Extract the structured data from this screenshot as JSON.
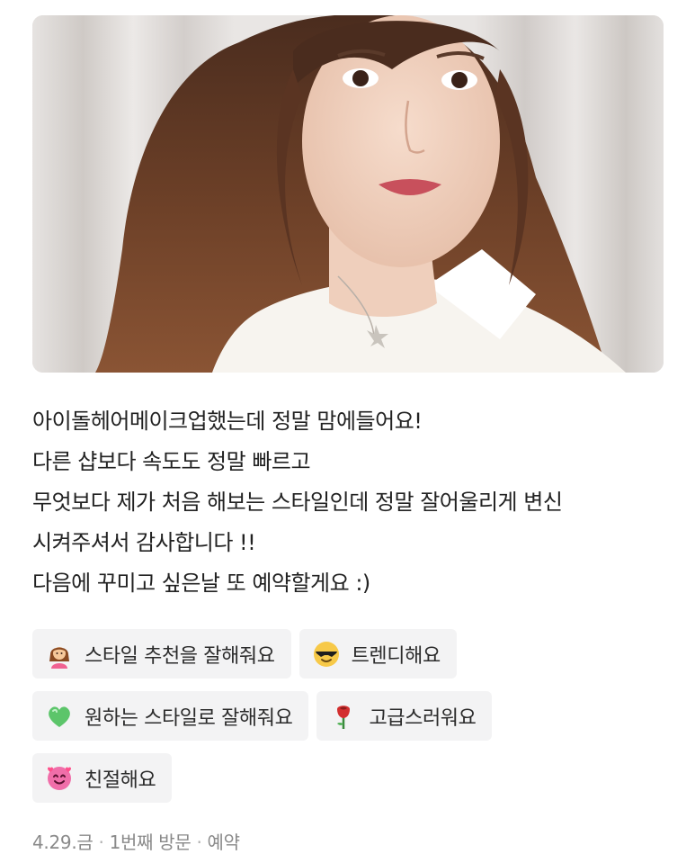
{
  "review": {
    "photo_alt": "selfie",
    "text_lines": [
      "아이돌헤어메이크업했는데 정말 맘에들어요!",
      "다른 샵보다 속도도 정말 빠르고",
      "무엇보다 제가 처음 해보는 스타일인데 정말 잘어울리게 변신",
      "시켜주셔서 감사합니다 !!",
      "다음에 꾸미고 싶은날 또 예약할게요 :)"
    ],
    "keywords": [
      {
        "label": "스타일 추천을 잘해줘요",
        "icon": "woman-hairdresser-icon"
      },
      {
        "label": "트렌디해요",
        "icon": "sunglasses-face-icon"
      },
      {
        "label": "원하는 스타일로 잘해줘요",
        "icon": "green-heart-icon"
      },
      {
        "label": "고급스러워요",
        "icon": "rose-icon"
      },
      {
        "label": "친절해요",
        "icon": "smiling-face-hearts-icon"
      }
    ],
    "meta": {
      "date": "4.29.금",
      "visit": "1번째 방문",
      "type": "예약"
    }
  },
  "colors": {
    "chip_bg": "#f3f3f4",
    "meta_text": "#8a8a8a",
    "body_text": "#222222"
  }
}
